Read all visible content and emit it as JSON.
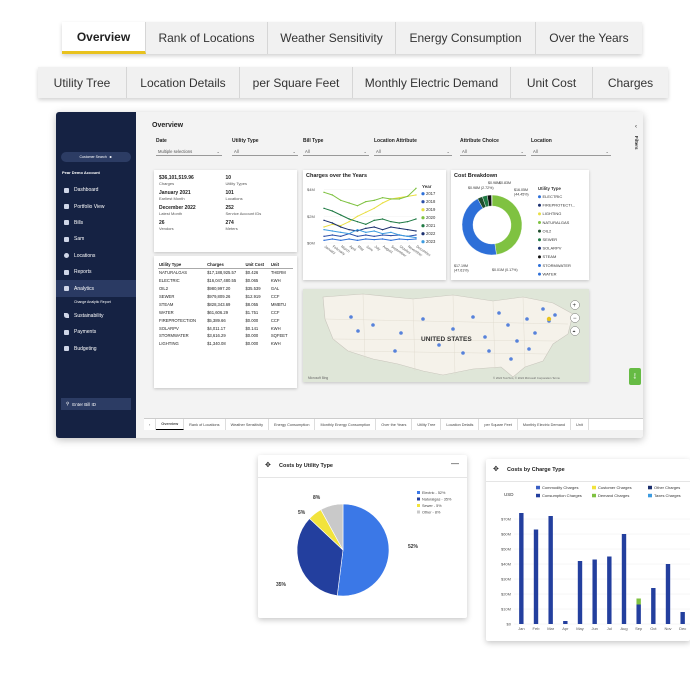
{
  "top_tabs": [
    "Overview",
    "Rank of Locations",
    "Weather Sensitivity",
    "Energy Consumption",
    "Over the Years"
  ],
  "second_tabs": [
    "Utility Tree",
    "Location Details",
    "per Square Feet",
    "Monthly Electric Demand",
    "Unit Cost",
    "Charges"
  ],
  "sidebar": {
    "search_label": "Customer Search",
    "account": "Pear Demo Account",
    "items": [
      {
        "label": "Dashboard",
        "icon": "dashboard-icon"
      },
      {
        "label": "Portfolio View",
        "icon": "portfolio-icon"
      },
      {
        "label": "Bills",
        "icon": "bills-icon"
      },
      {
        "label": "Sam",
        "icon": "chat-icon"
      },
      {
        "label": "Locations",
        "icon": "location-pin-icon"
      },
      {
        "label": "Reports",
        "icon": "reports-icon"
      },
      {
        "label": "Analytics",
        "icon": "analytics-icon"
      }
    ],
    "sub_item": "Change Analytic Report",
    "items_after": [
      {
        "label": "Sustainability",
        "icon": "leaf-icon"
      },
      {
        "label": "Payments",
        "icon": "payments-icon"
      },
      {
        "label": "Budgeting",
        "icon": "budget-icon"
      }
    ],
    "bill_id": "Enter Bill ID"
  },
  "overview": {
    "title": "Overview",
    "filters_label": "Filters",
    "filters": [
      {
        "label": "Date",
        "value": "Multiple selections"
      },
      {
        "label": "Utility Type",
        "value": "All"
      },
      {
        "label": "Bill Type",
        "value": "All"
      },
      {
        "label": "Location Attribute",
        "value": "All"
      },
      {
        "label": "Attribute Choice",
        "value": "All"
      },
      {
        "label": "Location",
        "value": "All"
      }
    ],
    "kpis": [
      {
        "value": "$36,101,519.96",
        "label": "Charges"
      },
      {
        "value": "10",
        "label": "Utility Types"
      },
      {
        "value": "January 2021",
        "label": "Earliest Month"
      },
      {
        "value": "101",
        "label": "Locations"
      },
      {
        "value": "December 2022",
        "label": "Latest Month"
      },
      {
        "value": "252",
        "label": "Service Account IDs"
      },
      {
        "value": "26",
        "label": "Vendors"
      },
      {
        "value": "274",
        "label": "Meters"
      }
    ],
    "table": {
      "headers": [
        "Utility Type",
        "Charges",
        "Unit Cost",
        "Unit"
      ],
      "rows": [
        [
          "NATURALGAS",
          "$17,188,925.57",
          "$0.426",
          "THERM"
        ],
        [
          "ELECTRIC",
          "$16,047,480.55",
          "$0.065",
          "KWH"
        ],
        [
          "OIL2",
          "$980,997.20",
          "$35.539",
          "GAL"
        ],
        [
          "SEWER",
          "$979,809.26",
          "$12.919",
          "CCF"
        ],
        [
          "STEAM",
          "$828,343.69",
          "$8.055",
          "MMBTU"
        ],
        [
          "WATER",
          "$61,606.29",
          "$1.751",
          "CCF"
        ],
        [
          "FIREPROTECTION",
          "$5,389.66",
          "$0.000",
          "CCF"
        ],
        [
          "SOLARPV",
          "$4,011.17",
          "$0.141",
          "KWH"
        ],
        [
          "STORMWATER",
          "$3,616.29",
          "$0.000",
          "SQFEET"
        ],
        [
          "LIGHTING",
          "$1,340.08",
          "$0.000",
          "KWH"
        ]
      ]
    },
    "map_label": "UNITED STATES",
    "map_credit": "© 2024 TomTom, © 2024 Microsoft Corporation  Terms",
    "map_logo": "Microsoft Bing",
    "green_tab": "Help",
    "bottom_tabs": [
      "Overview",
      "Rank of Locations",
      "Weather Sensitivity",
      "Energy Consumption",
      "Monthly Energy Consumption",
      "Over the Years",
      "Utility Tree",
      "Location Details",
      "per Square Feet",
      "Monthly Electric Demand",
      "Unit"
    ]
  },
  "colors": {
    "sidebar": "#152243",
    "accent_yellow": "#e8c21e",
    "electric": "#3b78e7",
    "naturalgas": "#233f9e",
    "sewer": "#f2e33c",
    "other": "#c9c9c9",
    "green": "#7fc241"
  },
  "chart_data": [
    {
      "type": "line",
      "title": "Charges over the Years",
      "legend_title": "Year",
      "x": [
        "January",
        "February",
        "March",
        "April",
        "May",
        "June",
        "July",
        "August",
        "September",
        "October",
        "November",
        "December"
      ],
      "y_ticks": [
        "$0M",
        "$2M",
        "$4M"
      ],
      "ylim": [
        0,
        4.2
      ],
      "series": [
        {
          "name": "2017",
          "color": "#2d6fd8",
          "values": [
            0.2,
            0.3,
            0.2,
            0.3,
            0.2,
            0.3,
            0.25,
            0.3,
            0.2,
            0.3,
            0.25,
            0.3
          ]
        },
        {
          "name": "2018",
          "color": "#2b4ea8",
          "values": [
            0.5,
            0.6,
            0.5,
            0.7,
            0.5,
            0.6,
            0.5,
            0.6,
            0.55,
            0.6,
            0.5,
            0.6
          ]
        },
        {
          "name": "2019",
          "color": "#e9df45",
          "values": [
            1.2,
            1.4,
            1.3,
            1.6,
            2.0,
            2.3,
            2.6,
            3.0,
            3.3,
            3.4,
            3.5,
            3.6
          ]
        },
        {
          "name": "2020",
          "color": "#7fc241",
          "values": [
            3.8,
            3.6,
            3.2,
            3.0,
            2.8,
            3.1,
            3.2,
            3.4,
            3.3,
            3.3,
            3.5,
            4.1
          ]
        },
        {
          "name": "2021",
          "color": "#1f7a44",
          "values": [
            2.6,
            2.4,
            2.1,
            1.8,
            1.6,
            1.4,
            1.7,
            1.8,
            1.6,
            1.5,
            1.6,
            1.8
          ]
        },
        {
          "name": "2022",
          "color": "#1b2f6e",
          "values": [
            1.7,
            1.5,
            1.2,
            1.0,
            0.9,
            1.1,
            1.2,
            1.0,
            1.2,
            1.1,
            1.0,
            0.9
          ]
        },
        {
          "name": "2023",
          "color": "#3d9be0",
          "values": [
            1.0,
            0.9,
            0.8,
            0.7,
            1.0,
            0.8,
            0.9,
            0.7,
            0.8,
            0.6,
            0.5,
            0.4
          ]
        }
      ]
    },
    {
      "type": "pie",
      "title": "Cost Breakdown",
      "legend_title": "Utility Type",
      "legend": [
        "ELECTRIC",
        "FIREPROTECTI...",
        "LIGHTING",
        "NATURALGAS",
        "OIL2",
        "SEWER",
        "SOLARPV",
        "STEAM",
        "STORMWATER",
        "WATER"
      ],
      "legend_colors": [
        "#2d6fd8",
        "#1b2f6e",
        "#e9df45",
        "#7fc241",
        "#1f4d2c",
        "#1f7a44",
        "#1b2f6e",
        "#111111",
        "#2d6fd8",
        "#2d6fd8"
      ],
      "slices": [
        {
          "label": "$17.19M (47.61%)",
          "value": 47.61,
          "color": "#7fc241"
        },
        {
          "label": "$16.05M (44.45%)",
          "value": 44.45,
          "color": "#2d6fd8"
        },
        {
          "label": "$0.98M (2.72%)",
          "value": 2.72,
          "color": "#1f4d2c"
        },
        {
          "label": "$0.98M",
          "value": 2.71,
          "color": "#1f7a44"
        },
        {
          "label": "$0.83M",
          "value": 2.29,
          "color": "#111111"
        },
        {
          "label": "$0.01M (0.17%)",
          "value": 0.22,
          "color": "#9ec9f0"
        }
      ]
    },
    {
      "type": "pie",
      "title": "Costs by Utility Type",
      "legend": [
        "Electric - 52%",
        "Naturalgas - 35%",
        "Sewer - 5%",
        "Other - 8%"
      ],
      "slices": [
        {
          "label": "52%",
          "value": 52,
          "color": "#3b78e7"
        },
        {
          "label": "35%",
          "value": 35,
          "color": "#233f9e"
        },
        {
          "label": "5%",
          "value": 5,
          "color": "#f2e33c"
        },
        {
          "label": "8%",
          "value": 8,
          "color": "#c9c9c9"
        }
      ]
    },
    {
      "type": "bar",
      "title": "Costs by Charge Type",
      "ylabel": "USD",
      "legend": [
        "Commodity Charges",
        "Customer Charges",
        "Other Charges",
        "Consumption Charges",
        "Demand Charges",
        "Taxes Charges"
      ],
      "legend_colors": [
        "#3b5fc4",
        "#f2e33c",
        "#1b2f6e",
        "#233f9e",
        "#7fc241",
        "#3d9be0"
      ],
      "categories": [
        "Jan",
        "Feb",
        "Mar",
        "Apr",
        "May",
        "Jun",
        "Jul",
        "Aug",
        "Sep",
        "Oct",
        "Nov",
        "Dec"
      ],
      "y_ticks": [
        "$0",
        "$10M",
        "$20M",
        "$30M",
        "$40M",
        "$50M",
        "$60M",
        "$70M"
      ],
      "ylim": [
        0,
        80
      ],
      "values": [
        74,
        63,
        72,
        2,
        42,
        43,
        45,
        60,
        13,
        24,
        40,
        8
      ],
      "demand_values": [
        0,
        0,
        0,
        0,
        0,
        0,
        0,
        0,
        4,
        0,
        0,
        0
      ]
    }
  ]
}
